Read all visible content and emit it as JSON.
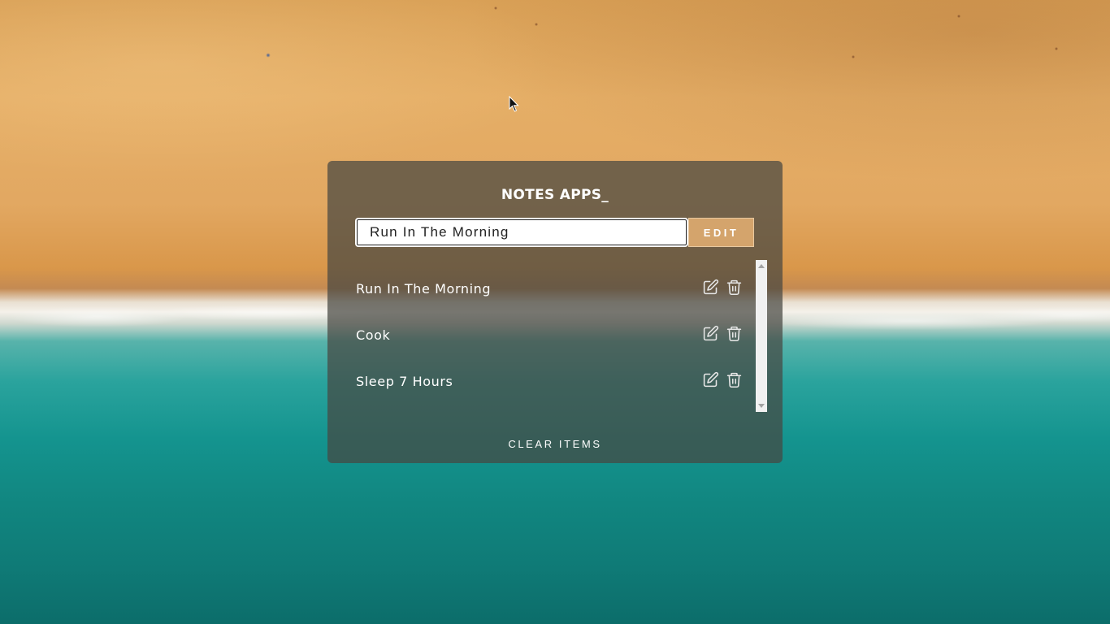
{
  "app": {
    "title": "NOTES APPS_"
  },
  "input": {
    "value": "Run In The Morning",
    "placeholder": ""
  },
  "edit_button": {
    "label": "EDIT",
    "color": "#d4a46c"
  },
  "notes": [
    {
      "label": "Run In The Morning",
      "edit_icon": "edit-icon",
      "delete_icon": "trash-icon"
    },
    {
      "label": "Cook",
      "edit_icon": "edit-icon",
      "delete_icon": "trash-icon"
    },
    {
      "label": "Sleep 7 Hours",
      "edit_icon": "edit-icon",
      "delete_icon": "trash-icon"
    }
  ],
  "clear_button": {
    "label": "CLEAR ITEMS"
  },
  "icons": {
    "cursor": "mouse-pointer-icon"
  }
}
